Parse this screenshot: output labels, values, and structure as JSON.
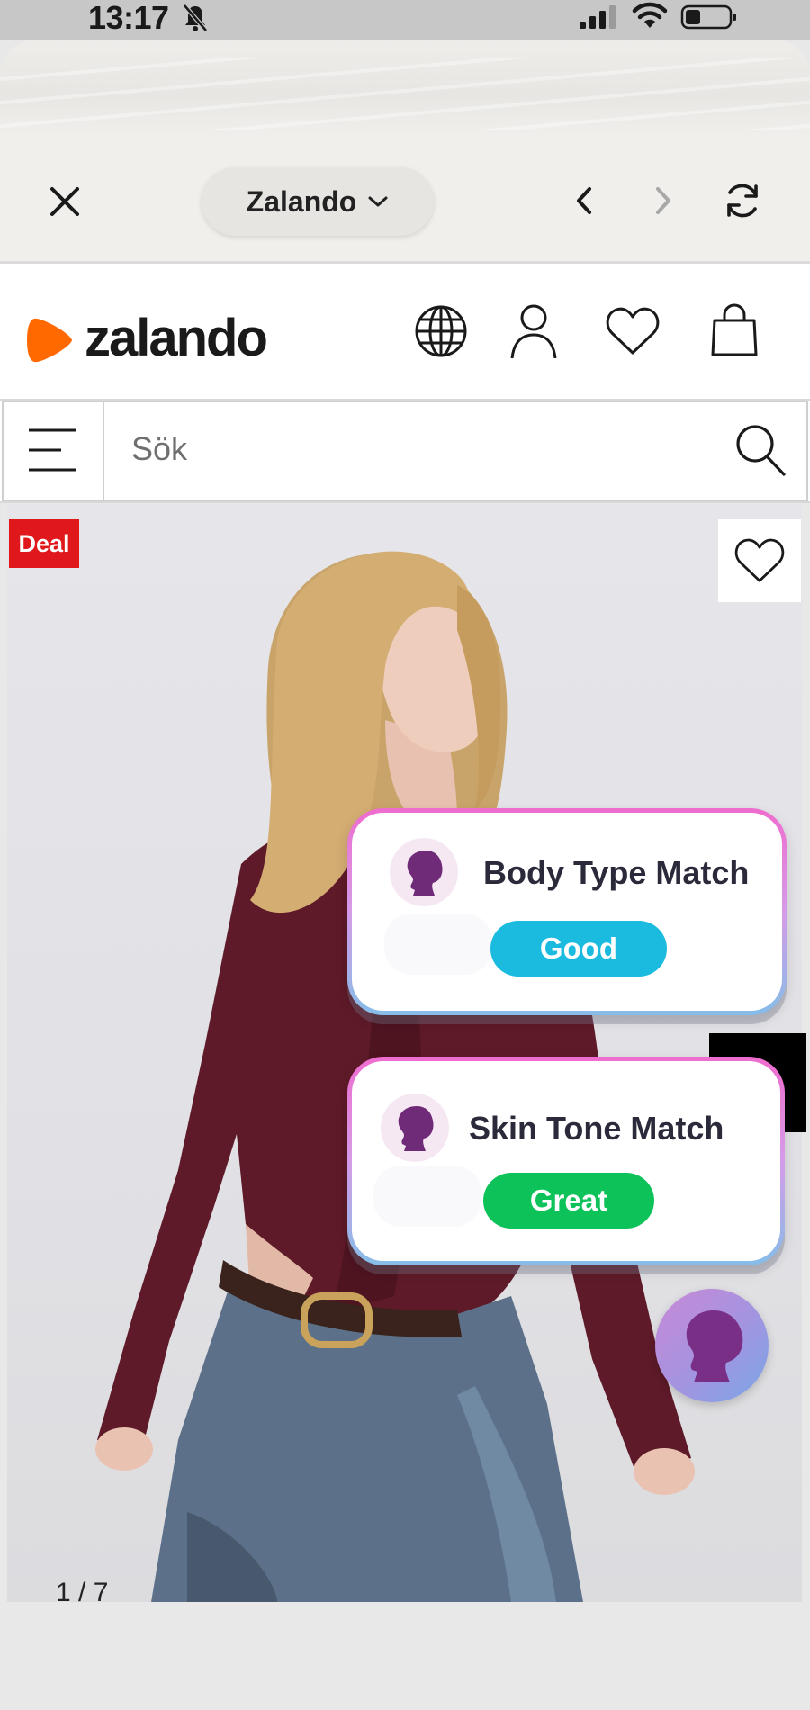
{
  "status_bar": {
    "time": "13:17",
    "icons": [
      "bell-muted-icon",
      "signal-icon",
      "wifi-icon",
      "battery-icon"
    ]
  },
  "browser": {
    "site_name": "Zalando",
    "controls": [
      "close-icon",
      "chevron-down-icon",
      "back-icon",
      "forward-icon",
      "reload-icon"
    ]
  },
  "header": {
    "logo_text": "zalando",
    "brand_color": "#ff6900",
    "icons": [
      "globe-icon",
      "user-icon",
      "heart-icon",
      "bag-icon"
    ]
  },
  "search": {
    "placeholder": "Sök"
  },
  "product": {
    "deal_label": "Deal",
    "deal_color": "#e0171b",
    "page_counter": "1 / 7"
  },
  "match_cards": [
    {
      "title": "Body Type Match",
      "rating": "Good",
      "rating_color": "#1bbbe0"
    },
    {
      "title": "Skin Tone Match",
      "rating": "Great",
      "rating_color": "#0ec25a"
    }
  ]
}
